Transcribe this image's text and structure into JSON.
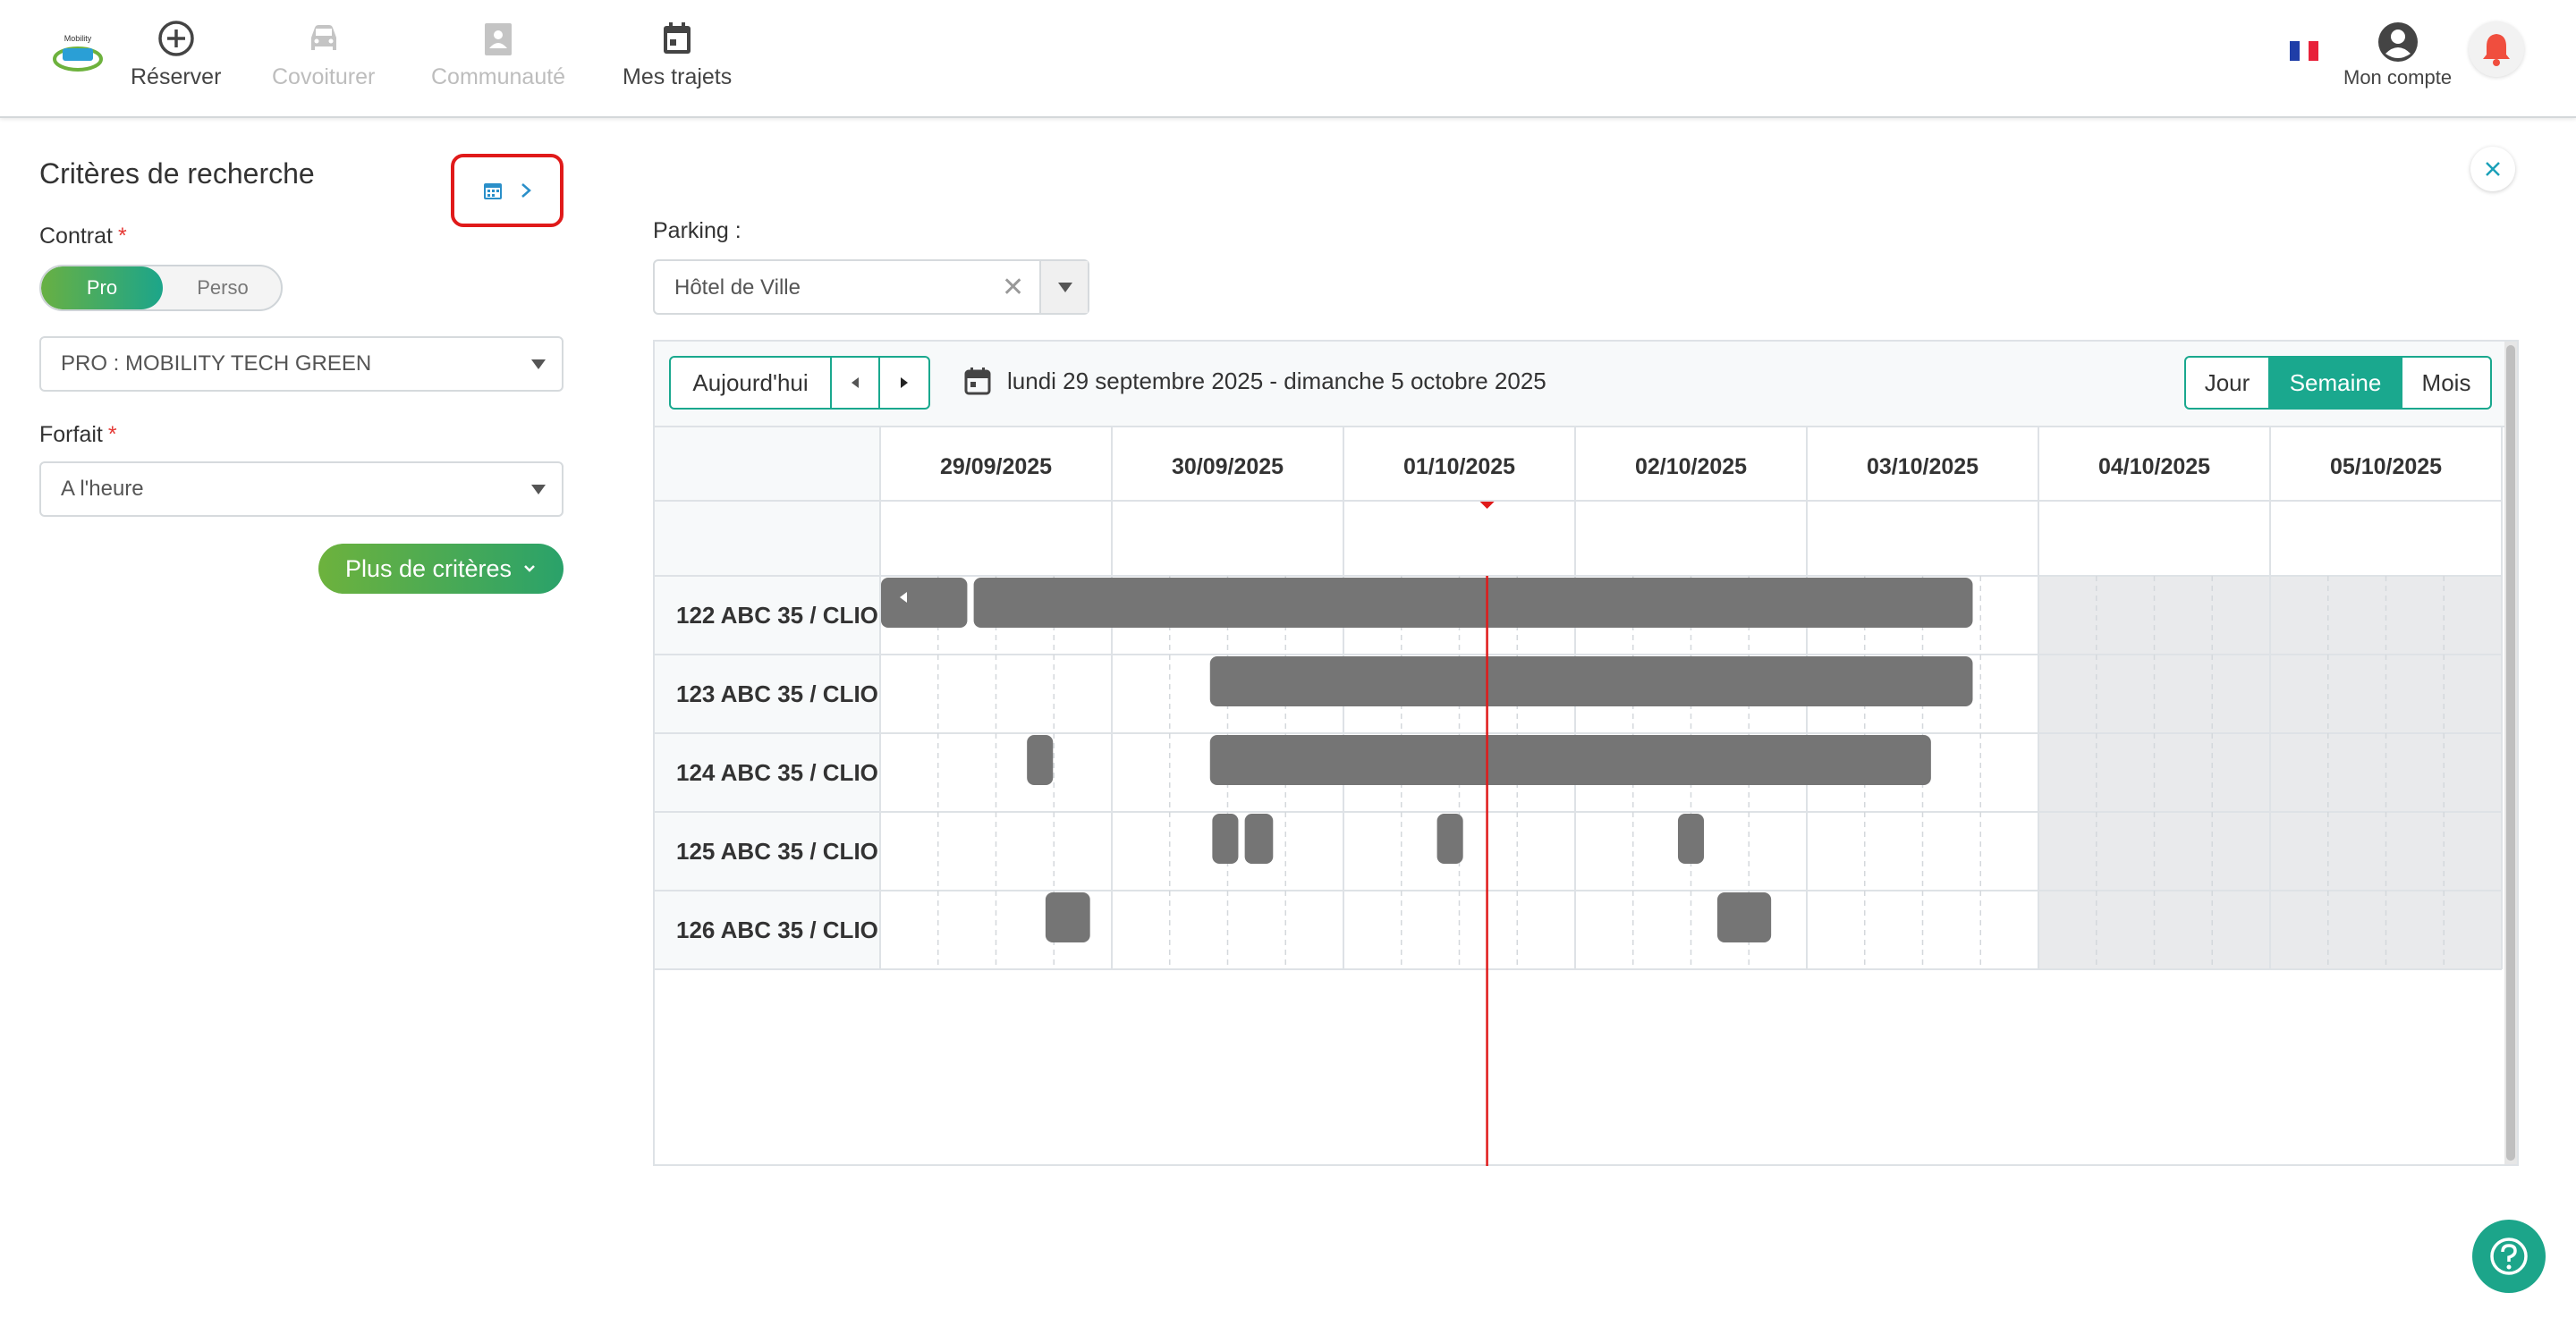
{
  "nav": {
    "items": [
      {
        "label": "Réserver",
        "icon": "plus-circle-icon",
        "enabled": true
      },
      {
        "label": "Covoiturer",
        "icon": "car-icon",
        "enabled": false
      },
      {
        "label": "Communauté",
        "icon": "community-icon",
        "enabled": false
      },
      {
        "label": "Mes trajets",
        "icon": "calendar-icon",
        "enabled": true
      }
    ],
    "account_label": "Mon compte",
    "language_flag": "fr",
    "logo_text": "Mobility"
  },
  "search": {
    "title": "Critères de recherche",
    "contract_label": "Contrat",
    "contract_options": [
      "Pro",
      "Perso"
    ],
    "contract_selected": "Pro",
    "company_value": "PRO : MOBILITY TECH GREEN",
    "package_label": "Forfait",
    "package_value": "A l'heure",
    "more_button": "Plus de critères"
  },
  "parking": {
    "label": "Parking :",
    "value": "Hôtel de Ville"
  },
  "calendar": {
    "today_button": "Aujourd'hui",
    "range_text": "lundi 29 septembre 2025 - dimanche 5 octobre 2025",
    "views": [
      "Jour",
      "Semaine",
      "Mois"
    ],
    "active_view": "Semaine",
    "days": [
      "29/09/2025",
      "30/09/2025",
      "01/10/2025",
      "02/10/2025",
      "03/10/2025",
      "04/10/2025",
      "05/10/2025"
    ],
    "now_position_days": 2.62,
    "rows": [
      {
        "label": "122 ABC 35 / CLIO",
        "bookings": [
          {
            "start": 0.0,
            "end": 0.38,
            "continues_left": true
          },
          {
            "start": 0.4,
            "end": 4.72
          }
        ]
      },
      {
        "label": "123 ABC 35 / CLIO",
        "bookings": [
          {
            "start": 1.42,
            "end": 4.72
          }
        ]
      },
      {
        "label": "124 ABC 35 / CLIO",
        "bookings": [
          {
            "start": 0.63,
            "end": 0.75
          },
          {
            "start": 1.42,
            "end": 4.54
          }
        ]
      },
      {
        "label": "125 ABC 35 / CLIO",
        "bookings": [
          {
            "start": 1.43,
            "end": 1.55
          },
          {
            "start": 1.57,
            "end": 1.7
          },
          {
            "start": 2.4,
            "end": 2.52
          },
          {
            "start": 3.44,
            "end": 3.56
          }
        ]
      },
      {
        "label": "126 ABC 35 / CLIO",
        "bookings": [
          {
            "start": 0.71,
            "end": 0.91
          },
          {
            "start": 3.61,
            "end": 3.85
          }
        ]
      }
    ]
  },
  "colors": {
    "accent": "#1aa88e",
    "booking": "#757575",
    "now_line": "#e01a1a",
    "weekend": "#e9eaec"
  }
}
